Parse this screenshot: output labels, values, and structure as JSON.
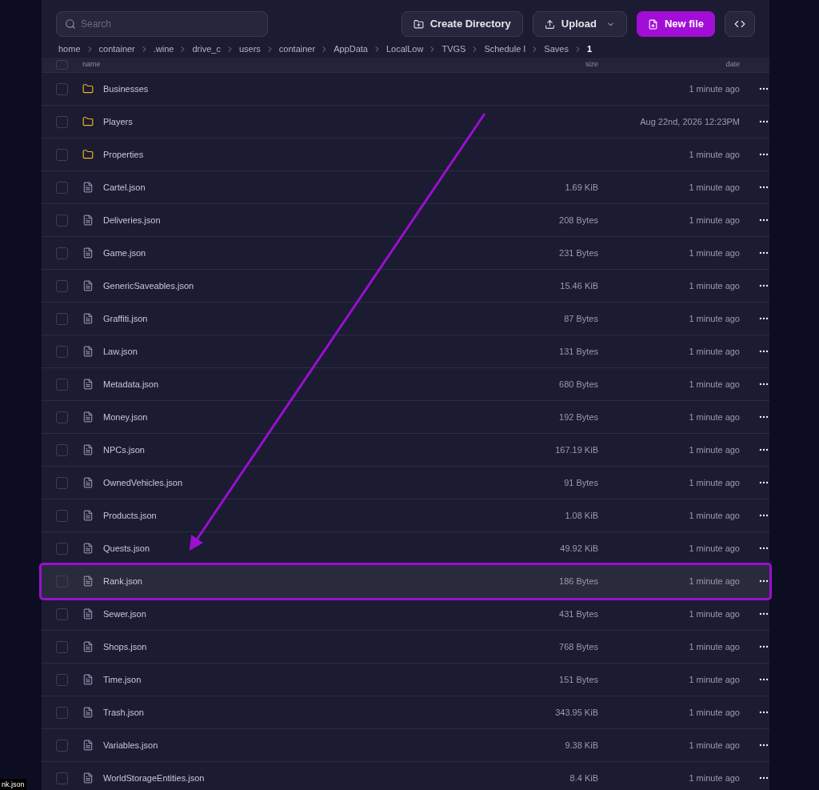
{
  "toolbar": {
    "search": {
      "placeholder": "Search"
    },
    "buttons": [
      {
        "label": "Create Directory",
        "kind": "directory"
      },
      {
        "label": "Upload",
        "kind": "upload"
      },
      {
        "label": "New file",
        "kind": "newfile"
      }
    ]
  },
  "breadcrumb": [
    "home",
    "container",
    ".wine",
    "drive_c",
    "users",
    "container",
    "AppData",
    "LocalLow",
    "TVGS",
    "Schedule I",
    "Saves",
    "1"
  ],
  "table": {
    "columns": [
      "name",
      "size",
      "date"
    ],
    "all_checked": false,
    "rows": [
      {
        "kind": "folder",
        "name": "Businesses",
        "size": "",
        "date": "1 minute ago",
        "highlighted": false
      },
      {
        "kind": "folder",
        "name": "Players",
        "size": "",
        "date": "Aug 22nd, 2026 12:23PM",
        "highlighted": false
      },
      {
        "kind": "folder",
        "name": "Properties",
        "size": "",
        "date": "1 minute ago",
        "highlighted": false
      },
      {
        "kind": "file",
        "name": "Cartel.json",
        "size": "1.69 KiB",
        "date": "1 minute ago",
        "highlighted": false
      },
      {
        "kind": "file",
        "name": "Deliveries.json",
        "size": "208 Bytes",
        "date": "1 minute ago",
        "highlighted": false
      },
      {
        "kind": "file",
        "name": "Game.json",
        "size": "231 Bytes",
        "date": "1 minute ago",
        "highlighted": false
      },
      {
        "kind": "file",
        "name": "GenericSaveables.json",
        "size": "15.46 KiB",
        "date": "1 minute ago",
        "highlighted": false
      },
      {
        "kind": "file",
        "name": "Graffiti.json",
        "size": "87 Bytes",
        "date": "1 minute ago",
        "highlighted": false
      },
      {
        "kind": "file",
        "name": "Law.json",
        "size": "131 Bytes",
        "date": "1 minute ago",
        "highlighted": false
      },
      {
        "kind": "file",
        "name": "Metadata.json",
        "size": "680 Bytes",
        "date": "1 minute ago",
        "highlighted": false
      },
      {
        "kind": "file",
        "name": "Money.json",
        "size": "192 Bytes",
        "date": "1 minute ago",
        "highlighted": false
      },
      {
        "kind": "file",
        "name": "NPCs.json",
        "size": "167.19 KiB",
        "date": "1 minute ago",
        "highlighted": false
      },
      {
        "kind": "file",
        "name": "OwnedVehicles.json",
        "size": "91 Bytes",
        "date": "1 minute ago",
        "highlighted": false
      },
      {
        "kind": "file",
        "name": "Products.json",
        "size": "1.08 KiB",
        "date": "1 minute ago",
        "highlighted": false
      },
      {
        "kind": "file",
        "name": "Quests.json",
        "size": "49.92 KiB",
        "date": "1 minute ago",
        "highlighted": false
      },
      {
        "kind": "file",
        "name": "Rank.json",
        "size": "186 Bytes",
        "date": "1 minute ago",
        "highlighted": true
      },
      {
        "kind": "file",
        "name": "Sewer.json",
        "size": "431 Bytes",
        "date": "1 minute ago",
        "highlighted": false
      },
      {
        "kind": "file",
        "name": "Shops.json",
        "size": "768 Bytes",
        "date": "1 minute ago",
        "highlighted": false
      },
      {
        "kind": "file",
        "name": "Time.json",
        "size": "151 Bytes",
        "date": "1 minute ago",
        "highlighted": false
      },
      {
        "kind": "file",
        "name": "Trash.json",
        "size": "343.95 KiB",
        "date": "1 minute ago",
        "highlighted": false
      },
      {
        "kind": "file",
        "name": "Variables.json",
        "size": "9.38 KiB",
        "date": "1 minute ago",
        "highlighted": false
      },
      {
        "kind": "file",
        "name": "WorldStorageEntities.json",
        "size": "8.4 KiB",
        "date": "1 minute ago",
        "highlighted": false
      }
    ]
  },
  "tooltip": "nk.json"
}
